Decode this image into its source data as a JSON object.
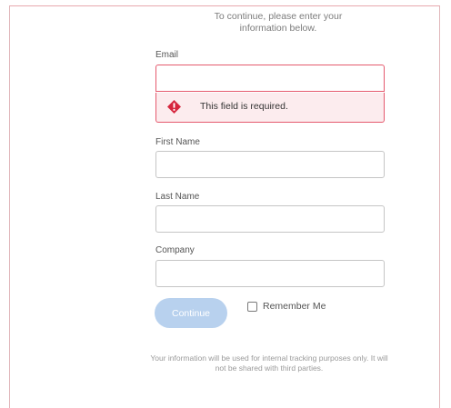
{
  "intro_text": "To continue, please enter your information below.",
  "fields": {
    "email": {
      "label": "Email",
      "value": "",
      "error": "This field is required."
    },
    "first_name": {
      "label": "First Name",
      "value": ""
    },
    "last_name": {
      "label": "Last Name",
      "value": ""
    },
    "company": {
      "label": "Company",
      "value": ""
    }
  },
  "actions": {
    "continue_label": "Continue",
    "remember_label": "Remember Me",
    "remember_checked": false
  },
  "footer_text": "Your information will be used for internal tracking purposes only. It will not be shared with third parties.",
  "colors": {
    "error": "#e55a6e",
    "error_bg": "#fcecee",
    "button": "#b8d1ee"
  },
  "icons": {
    "error": "warning-diamond-icon"
  }
}
